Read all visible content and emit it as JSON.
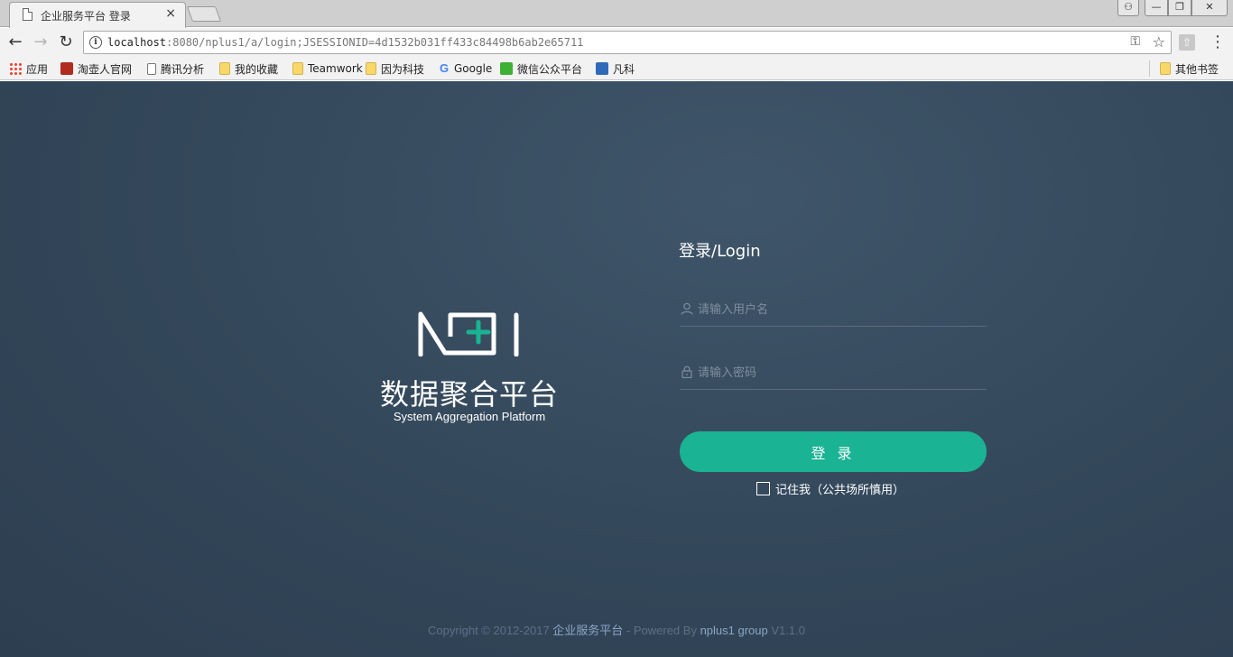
{
  "browser": {
    "tab": {
      "title": "企业服务平台 登录",
      "close_glyph": "×"
    },
    "window_controls": {
      "user": "⚇",
      "minimize": "—",
      "maximize": "❐",
      "close": "✕"
    },
    "nav": {
      "back": "←",
      "forward": "→",
      "reload": "↻"
    },
    "address": {
      "host": "localhost",
      "rest": ":8080/nplus1/a/login;JSESSIONID=4d1532b031ff433c84498b6ab2e65711"
    },
    "bookmarks": [
      {
        "label": "应用",
        "icon": "apps-icon"
      },
      {
        "label": "淘壶人官网",
        "icon": "taohu-icon"
      },
      {
        "label": "腾讯分析",
        "icon": "page-icon"
      },
      {
        "label": "我的收藏",
        "icon": "folder-icon"
      },
      {
        "label": "Teamwork",
        "icon": "folder-icon"
      },
      {
        "label": "因为科技",
        "icon": "folder-icon"
      },
      {
        "label": "Google",
        "icon": "google-icon"
      },
      {
        "label": "微信公众平台",
        "icon": "wechat-icon"
      },
      {
        "label": "凡科",
        "icon": "fanke-icon"
      }
    ],
    "other_bookmarks": "其他书签"
  },
  "brand": {
    "name_cn": "数据聚合平台",
    "name_en": "System Aggregation Platform",
    "accent": "#1ab394"
  },
  "login": {
    "title": "登录/Login",
    "username_placeholder": "请输入用户名",
    "password_placeholder": "请输入密码",
    "submit_label": "登 录",
    "remember_label": "记住我（公共场所慎用）"
  },
  "footer": {
    "copyright": "Copyright © 2012-2017 ",
    "company": "企业服务平台",
    "powered_prefix": " - Powered By ",
    "group": "nplus1 group",
    "version": " V1.1.0"
  }
}
